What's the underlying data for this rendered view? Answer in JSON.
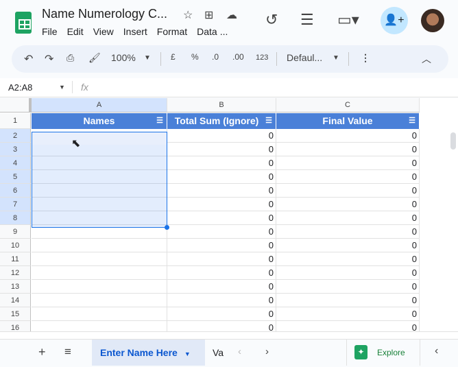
{
  "header": {
    "title": "Name Numerology C...",
    "menu": [
      "File",
      "Edit",
      "View",
      "Insert",
      "Format",
      "Data",
      "..."
    ]
  },
  "toolbar": {
    "zoom": "100%",
    "currency": "£",
    "percent": "%",
    "dec_dec": ".0",
    "inc_dec": ".00",
    "format_123": "123",
    "font": "Defaul..."
  },
  "formula_bar": {
    "name_box": "A2:A8",
    "fx": "fx"
  },
  "grid": {
    "columns": [
      "A",
      "B",
      "C"
    ],
    "headers": [
      "Names",
      "Total Sum (Ignore)",
      "Final Value"
    ],
    "rows": [
      2,
      3,
      4,
      5,
      6,
      7,
      8,
      9,
      10,
      11,
      12,
      13,
      14,
      15,
      16
    ],
    "value": "0",
    "selection": "A2:A8"
  },
  "sheets": {
    "active": "Enter Name Here",
    "next": "Va",
    "explore": "Explore"
  },
  "colors": {
    "header_fill": "#4a80d8",
    "selection": "#1a73e8",
    "brand": "#1ea362"
  }
}
